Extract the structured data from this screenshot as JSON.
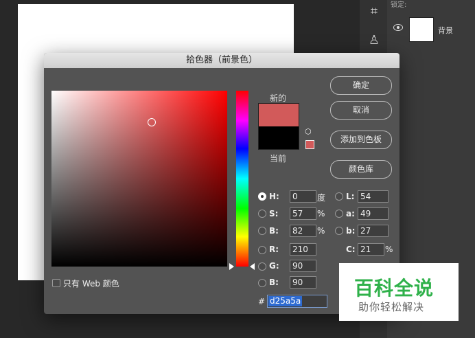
{
  "background": {
    "lock_label": "锁定:",
    "layer_name": "背景"
  },
  "dialog": {
    "title": "拾色器（前景色）",
    "new_label": "新的",
    "current_label": "当前",
    "buttons": {
      "ok": "确定",
      "cancel": "取消",
      "add_to_swatches": "添加到色板",
      "color_libraries": "颜色库"
    },
    "fields": {
      "H": {
        "label": "H:",
        "value": "0",
        "unit": "度"
      },
      "S": {
        "label": "S:",
        "value": "57",
        "unit": "%"
      },
      "Bv": {
        "label": "B:",
        "value": "82",
        "unit": "%"
      },
      "R": {
        "label": "R:",
        "value": "210"
      },
      "G": {
        "label": "G:",
        "value": "90"
      },
      "B": {
        "label": "B:",
        "value": "90"
      },
      "L": {
        "label": "L:",
        "value": "54"
      },
      "a": {
        "label": "a:",
        "value": "49"
      },
      "b": {
        "label": "b:",
        "value": "27"
      },
      "C": {
        "label": "C:",
        "value": "21",
        "unit": "%"
      }
    },
    "web_colors_label": "只有 Web 颜色",
    "hash": "#",
    "hex": "d25a5a",
    "colors": {
      "new": "#d25a5a",
      "current": "#000000"
    }
  },
  "watermark": {
    "title": "百科全说",
    "subtitle": "助你轻松解决"
  }
}
